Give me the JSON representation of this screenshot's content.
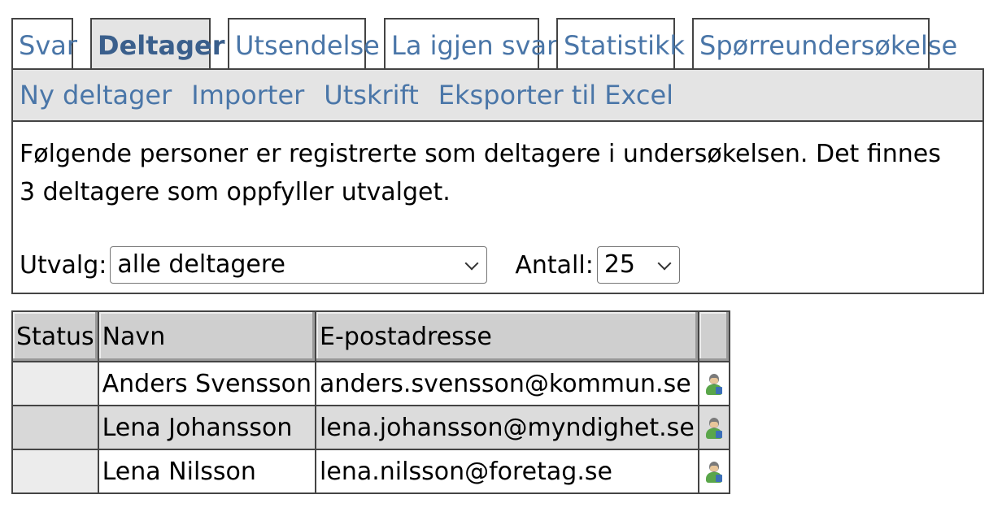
{
  "tabs": [
    {
      "label": "Svar",
      "active": false
    },
    {
      "label": "Deltager",
      "active": true
    },
    {
      "label": "Utsendelse",
      "active": false
    },
    {
      "label": "La igjen svar",
      "active": false
    },
    {
      "label": "Statistikk",
      "active": false
    },
    {
      "label": "Spørreundersøkelse",
      "active": false
    }
  ],
  "toolbar": {
    "new_participant": "Ny deltager",
    "import": "Importer",
    "print": "Utskrift",
    "export_excel": "Eksporter til Excel"
  },
  "description": "Følgende personer er registrerte som deltagere i undersøkelsen. Det finnes 3 deltagere som oppfyller utvalget.",
  "filter": {
    "utvalg_label": "Utvalg:",
    "utvalg_value": "alle deltagere",
    "antall_label": "Antall:",
    "antall_value": "25"
  },
  "table": {
    "headers": [
      "Status",
      "Navn",
      "E-postadresse",
      ""
    ],
    "rows": [
      {
        "status": "",
        "name": "Anders Svensson",
        "email": "anders.svensson@kommun.se",
        "icon": "user-details-icon"
      },
      {
        "status": "",
        "name": "Lena Johansson",
        "email": "lena.johansson@myndighet.se",
        "icon": "user-details-icon"
      },
      {
        "status": "",
        "name": "Lena Nilsson",
        "email": "lena.nilsson@foretag.se",
        "icon": "user-details-icon"
      }
    ]
  },
  "colors": {
    "link": "#4a76a8",
    "toolbar_bg": "#e4e4e4",
    "header_bg": "#cfcfcf"
  }
}
